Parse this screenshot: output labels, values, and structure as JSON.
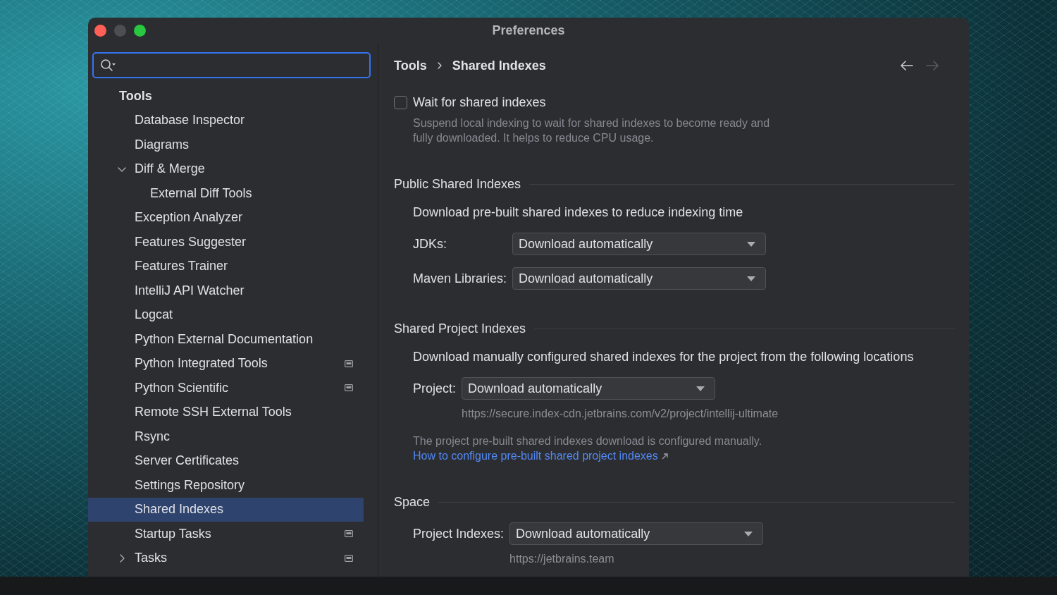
{
  "window": {
    "title": "Preferences",
    "controls": [
      {
        "kind": "close",
        "disabled": false
      },
      {
        "kind": "minimize",
        "disabled": true
      },
      {
        "kind": "zoom",
        "disabled": false
      }
    ]
  },
  "sidebar": {
    "search": {
      "focused": true
    },
    "items": [
      {
        "label": "Tools",
        "selected": false,
        "per_project": false,
        "children": [
          {
            "label": "Database Inspector",
            "selected": false,
            "per_project": false
          },
          {
            "label": "Diagrams",
            "selected": false,
            "per_project": false
          },
          {
            "label": "Diff & Merge",
            "selected": false,
            "per_project": false,
            "expanded": true,
            "children": [
              {
                "label": "External Diff Tools",
                "selected": false,
                "per_project": false
              }
            ]
          },
          {
            "label": "Exception Analyzer",
            "selected": false,
            "per_project": false
          },
          {
            "label": "Features Suggester",
            "selected": false,
            "per_project": false
          },
          {
            "label": "Features Trainer",
            "selected": false,
            "per_project": false
          },
          {
            "label": "IntelliJ API Watcher",
            "selected": false,
            "per_project": false
          },
          {
            "label": "Logcat",
            "selected": false,
            "per_project": false
          },
          {
            "label": "Python External Documentation",
            "selected": false,
            "per_project": false
          },
          {
            "label": "Python Integrated Tools",
            "selected": false,
            "per_project": true
          },
          {
            "label": "Python Scientific",
            "selected": false,
            "per_project": true
          },
          {
            "label": "Remote SSH External Tools",
            "selected": false,
            "per_project": false
          },
          {
            "label": "Rsync",
            "selected": false,
            "per_project": false
          },
          {
            "label": "Server Certificates",
            "selected": false,
            "per_project": false
          },
          {
            "label": "Settings Repository",
            "selected": false,
            "per_project": false
          },
          {
            "label": "Shared Indexes",
            "selected": true,
            "per_project": false
          },
          {
            "label": "Startup Tasks",
            "selected": false,
            "per_project": true
          },
          {
            "label": "Tasks",
            "selected": false,
            "per_project": true,
            "expanded": false
          }
        ]
      }
    ]
  },
  "breadcrumbs": [
    "Tools",
    "Shared Indexes"
  ],
  "nav_buttons": [
    {
      "kind": "back",
      "disabled": false
    },
    {
      "kind": "forward",
      "disabled": true
    }
  ],
  "wait_option": {
    "label": "Wait for shared indexes",
    "checked": false,
    "description": "Suspend local indexing to wait for shared indexes to become ready and fully downloaded. It helps to reduce CPU usage."
  },
  "sections": [
    {
      "title": "Public Shared Indexes",
      "intro": "Download pre-built shared indexes to reduce indexing time",
      "fields": [
        {
          "label": "JDKs:",
          "value": "Download automatically"
        },
        {
          "label": "Maven Libraries:",
          "value": "Download automatically"
        }
      ]
    },
    {
      "title": "Shared Project Indexes",
      "intro": "Download manually configured shared indexes for the project from the following locations",
      "fields": [
        {
          "label": "Project:",
          "value": "Download automatically",
          "hint": "https://secure.index-cdn.jetbrains.com/v2/project/intellij-ultimate"
        }
      ],
      "note": {
        "text": "The project pre-built shared indexes download is configured manually.",
        "link": "How to configure pre-built shared project indexes"
      }
    },
    {
      "title": "Space",
      "fields": [
        {
          "label": "Project Indexes:",
          "value": "Download automatically",
          "hint": "https://jetbrains.team"
        }
      ]
    }
  ]
}
